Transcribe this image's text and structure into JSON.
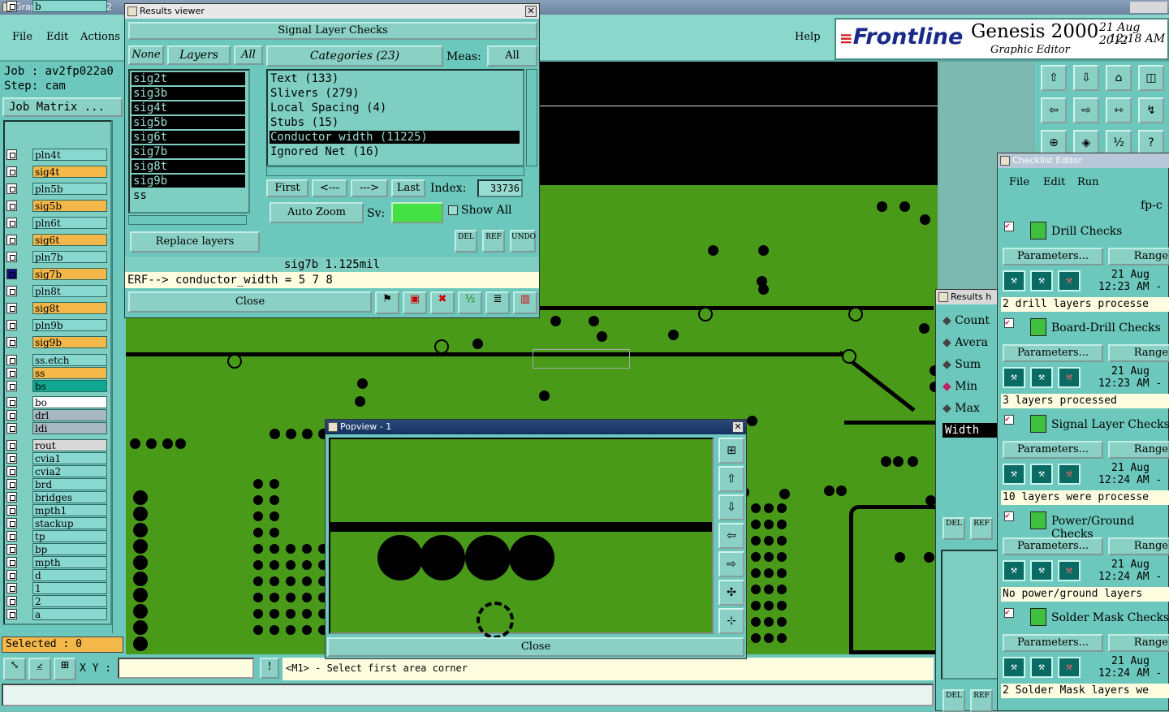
{
  "app": {
    "title": "Graphic Editor 9.02c2",
    "menu": [
      "File",
      "Edit",
      "Actions"
    ],
    "help": "Help",
    "brand": "Frontline",
    "product": "Genesis 2000",
    "subtitle": "Graphic Editor",
    "date": "21 Aug 2012",
    "time": "12:18 AM",
    "job_label": "Job : av2fp022a0",
    "step_label": "Step: cam",
    "job_matrix": "Job Matrix ...",
    "selected": "Selected : 0",
    "xy_label": "X Y :",
    "prompt": "<M1> - Select first area corner",
    "layers": [
      {
        "name": "sig3b",
        "bg": "#f4b84a"
      },
      {
        "name": "pln4t",
        "bg": "#88d8d0"
      },
      {
        "name": "sig4t",
        "bg": "#f4b84a"
      },
      {
        "name": "pln5b",
        "bg": "#88d8d0"
      },
      {
        "name": "sig5b",
        "bg": "#f4b84a"
      },
      {
        "name": "pln6t",
        "bg": "#88d8d0"
      },
      {
        "name": "sig6t",
        "bg": "#f4b84a"
      },
      {
        "name": "pln7b",
        "bg": "#88d8d0"
      },
      {
        "name": "sig7b",
        "bg": "#f4b84a"
      },
      {
        "name": "pln8t",
        "bg": "#88d8d0"
      },
      {
        "name": "sig8t",
        "bg": "#f4b84a"
      },
      {
        "name": "pln9b",
        "bg": "#88d8d0"
      },
      {
        "name": "sig9b",
        "bg": "#f4b84a"
      },
      {
        "name": "ss.etch",
        "bg": "#88d8d0"
      },
      {
        "name": "ss",
        "bg": "#f4b84a"
      },
      {
        "name": "bs",
        "bg": "#10a890"
      },
      {
        "name": "bo",
        "bg": "#ffffff"
      },
      {
        "name": "drl",
        "bg": "#a8b8c0"
      },
      {
        "name": "ldi",
        "bg": "#a8b8c0"
      },
      {
        "name": "rout",
        "bg": "#d8d8d8"
      },
      {
        "name": "cvia1",
        "bg": "#88d8d0"
      },
      {
        "name": "cvia2",
        "bg": "#88d8d0"
      },
      {
        "name": "brd",
        "bg": "#88d8d0"
      },
      {
        "name": "bridges",
        "bg": "#88d8d0"
      },
      {
        "name": "mpth1",
        "bg": "#88d8d0"
      },
      {
        "name": "stackup",
        "bg": "#88d8d0"
      },
      {
        "name": "tp",
        "bg": "#88d8d0"
      },
      {
        "name": "bp",
        "bg": "#88d8d0"
      },
      {
        "name": "mpth",
        "bg": "#88d8d0"
      },
      {
        "name": "d",
        "bg": "#88d8d0"
      },
      {
        "name": "1",
        "bg": "#88d8d0"
      },
      {
        "name": "2",
        "bg": "#88d8d0"
      },
      {
        "name": "a",
        "bg": "#88d8d0"
      },
      {
        "name": "b",
        "bg": "#88d8d0"
      }
    ]
  },
  "results": {
    "title": "Results viewer",
    "heading": "Signal Layer Checks",
    "none": "None",
    "layers_hdr": "Layers",
    "all": "All",
    "categories_hdr": "Categories (23)",
    "meas": "Meas:",
    "meas_val": "All",
    "layer_list": [
      "sig2t",
      "sig3b",
      "sig4t",
      "sig5b",
      "sig6t",
      "sig7b",
      "sig8t",
      "sig9b",
      "ss"
    ],
    "category_list": [
      "Text (133)",
      "Slivers (279)",
      "Local Spacing (4)",
      "Stubs (15)",
      "Conductor width (11225)",
      "Ignored Net (16)"
    ],
    "selected_category": "Conductor width (11225)",
    "first": "First",
    "prev": "<---",
    "next": "--->",
    "last": "Last",
    "index_label": "Index:",
    "index_val": "33736",
    "auto_zoom": "Auto Zoom",
    "sv": "Sv:",
    "show_all": "Show All",
    "replace_layers": "Replace layers",
    "del": "DEL",
    "ref": "REF",
    "undo": "UNDO",
    "status": "sig7b 1.125mil",
    "erf": "ERF--> conductor_width = 5 7 8",
    "close": "Close"
  },
  "popview": {
    "title": "Popview - 1",
    "close": "Close"
  },
  "results_small": {
    "title": "Results h",
    "options": [
      "Count",
      "Avera",
      "Sum",
      "Min",
      "Max"
    ],
    "selected": "Min",
    "width": "Width",
    "del": "DEL",
    "ref": "REF"
  },
  "checklist": {
    "title": "Checklist Editor",
    "menu": [
      "File",
      "Edit",
      "Run"
    ],
    "partname": "fp-c",
    "parameters": "Parameters...",
    "ranges": "Range",
    "items": [
      {
        "name": "Drill Checks",
        "date": "21 Aug",
        "time": "12:23 AM -",
        "status": "2 drill layers processe"
      },
      {
        "name": "Board-Drill Checks",
        "date": "21 Aug",
        "time": "12:23 AM -",
        "status": "3 layers processed"
      },
      {
        "name": "Signal Layer Checks",
        "date": "21 Aug",
        "time": "12:24 AM -",
        "status": "10 layers were processe"
      },
      {
        "name": "Power/Ground Checks",
        "date": "21 Aug",
        "time": "12:24 AM -",
        "status": "No power/ground layers"
      },
      {
        "name": "Solder Mask Checks",
        "date": "21 Aug",
        "time": "12:24 AM -",
        "status": "2 Solder Mask layers we"
      }
    ]
  },
  "colors": {
    "board": "#4a9a1a",
    "panel": "#7ecfc2",
    "window_bg": "#e8e8e8"
  }
}
